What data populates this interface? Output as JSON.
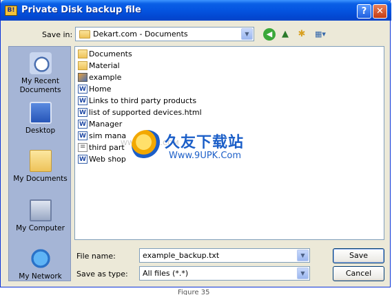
{
  "window": {
    "title": "Private Disk backup file",
    "help_glyph": "?",
    "close_glyph": "✕",
    "app_icon": "private-disk-icon"
  },
  "save_in": {
    "label": "Save in:",
    "value": "Dekart.com - Documents",
    "toolbar_icons": [
      "back-icon",
      "up-folder-icon",
      "new-folder-icon",
      "views-menu-icon"
    ]
  },
  "places": [
    {
      "label": "My Recent Documents",
      "icon": "recent-documents-icon"
    },
    {
      "label": "Desktop",
      "icon": "desktop-icon"
    },
    {
      "label": "My Documents",
      "icon": "my-documents-icon"
    },
    {
      "label": "My Computer",
      "icon": "my-computer-icon"
    },
    {
      "label": "My Network",
      "icon": "my-network-icon"
    }
  ],
  "files": [
    {
      "name": "Documents",
      "icon": "folder-icon"
    },
    {
      "name": "Material",
      "icon": "folder-icon"
    },
    {
      "name": "example",
      "icon": "image-file-icon"
    },
    {
      "name": "Home",
      "icon": "word-document-icon"
    },
    {
      "name": "Links to third party products",
      "icon": "word-document-icon"
    },
    {
      "name": "list of supported devices.html",
      "icon": "word-document-icon"
    },
    {
      "name": "Manager",
      "icon": "word-document-icon"
    },
    {
      "name": "sim mana",
      "icon": "word-document-icon"
    },
    {
      "name": "third part",
      "icon": "text-file-icon"
    },
    {
      "name": "Web shop",
      "icon": "word-document-icon"
    }
  ],
  "watermark": {
    "chinese": "久友下载站",
    "url": "Www.9UPK.Com",
    "faint": "WWW.9UPK.COM"
  },
  "file_name": {
    "label": "File name:",
    "value": "example_backup.txt"
  },
  "save_as_type": {
    "label": "Save as type:",
    "value": "All files (*.*)"
  },
  "buttons": {
    "save": "Save",
    "cancel": "Cancel"
  },
  "caption": "Figure 35"
}
